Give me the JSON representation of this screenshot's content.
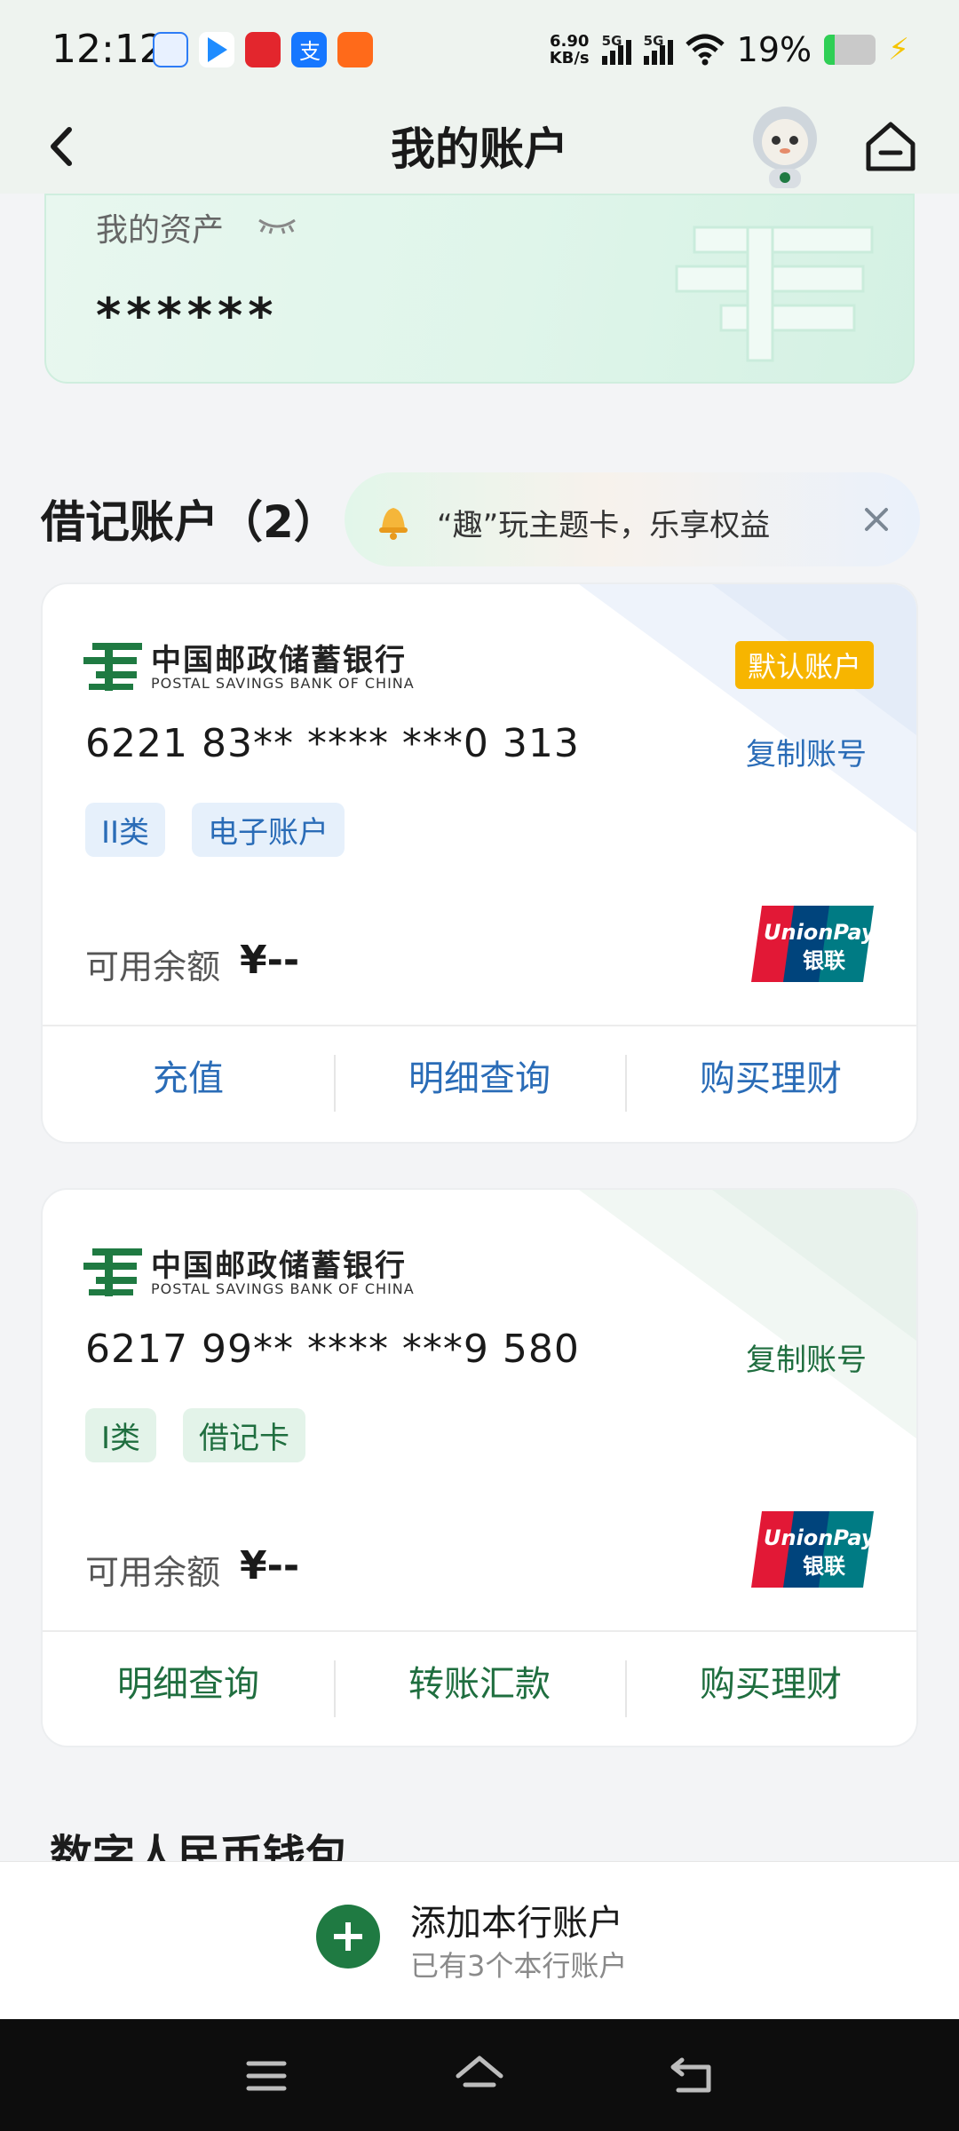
{
  "status_bar": {
    "time": "12:12",
    "speed_top": "6.90",
    "speed_bottom": "KB/s",
    "signal1": "5G",
    "signal2": "5G",
    "battery": "19%"
  },
  "nav": {
    "title": "我的账户"
  },
  "assets": {
    "label": "我的资产",
    "value": "******"
  },
  "debit_section": {
    "title": "借记账户（2）",
    "promo_text": "“趣”玩主题卡，乐享权益"
  },
  "accounts": [
    {
      "bank_cn": "中国邮政储蓄银行",
      "bank_en": "POSTAL SAVINGS BANK OF CHINA",
      "badge": "默认账户",
      "number": "6221 83** **** ***0 313",
      "copy_label": "复制账号",
      "tags": [
        "II类",
        "电子账户"
      ],
      "balance_label": "可用余额",
      "balance_value": "¥--",
      "actions": [
        "充值",
        "明细查询",
        "购买理财"
      ]
    },
    {
      "bank_cn": "中国邮政储蓄银行",
      "bank_en": "POSTAL SAVINGS BANK OF CHINA",
      "number": "6217 99** **** ***9 580",
      "copy_label": "复制账号",
      "tags": [
        "I类",
        "借记卡"
      ],
      "balance_label": "可用余额",
      "balance_value": "¥--",
      "actions": [
        "明细查询",
        "转账汇款",
        "购买理财"
      ]
    }
  ],
  "unionpay": {
    "en": "UnionPay",
    "cn": "银联"
  },
  "digital_wallet": {
    "title": "数字人民币钱包"
  },
  "add_account": {
    "title": "添加本行账户",
    "subtitle": "已有3个本行账户"
  },
  "colors": {
    "brand_green": "#1f7a42",
    "link_blue": "#2a6cb7",
    "badge_gold": "#f7b500"
  }
}
